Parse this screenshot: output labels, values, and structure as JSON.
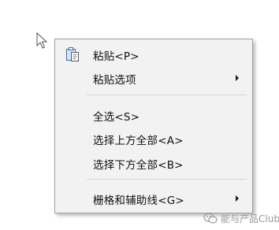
{
  "context_menu": {
    "items": [
      {
        "label": "粘贴<P>",
        "icon": "paste-icon",
        "submenu": false
      },
      {
        "label": "粘贴选项",
        "submenu": true
      },
      {
        "label": "全选<S>",
        "submenu": false
      },
      {
        "label": "选择上方全部<A>",
        "submenu": false
      },
      {
        "label": "选择下方全部<B>",
        "submenu": false
      },
      {
        "label": "栅格和辅助线<G>",
        "submenu": true
      }
    ]
  },
  "watermark": {
    "text": "能与产品Club",
    "icon": "wechat-icon"
  },
  "colors": {
    "menu_background": "#f2f2f2",
    "menu_border": "#a0a0a0",
    "icon_blue": "#3a6ea8"
  }
}
